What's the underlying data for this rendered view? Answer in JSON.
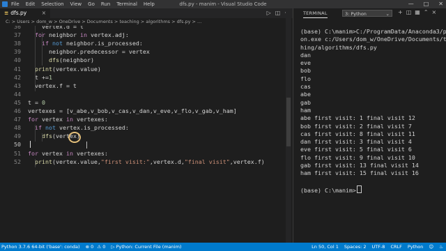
{
  "titlebar": {
    "menu": [
      "File",
      "Edit",
      "Selection",
      "View",
      "Go",
      "Run",
      "Terminal",
      "Help"
    ],
    "title": "dfs.py - manim - Visual Studio Code"
  },
  "editor": {
    "tab_label": "dfs.py",
    "breadcrumbs": "C: > Users > dom_w > OneDrive > Documents > teaching > algorithms > dfs.py > ..."
  },
  "terminal": {
    "tab_label": "TERMINAL",
    "shell_select": "3: Python",
    "lines": [
      "(base) C:\\manim>C:/ProgramData/Anaconda3/pyth",
      "on.exe c:/Users/dom_w/OneDrive/Documents/teac",
      "hing/algorithms/dfs.py",
      "dan",
      "eve",
      "bob",
      "flo",
      "cas",
      "abe",
      "gab",
      "ham",
      "abe first visit: 1 final visit 12",
      "bob first visit: 2 final visit 7",
      "cas first visit: 8 final visit 11",
      "dan first visit: 3 final visit 4",
      "eve first visit: 5 final visit 6",
      "flo first visit: 9 final visit 10",
      "gab first visit: 13 final visit 14",
      "ham first visit: 15 final visit 16",
      "",
      "(base) C:\\manim>"
    ]
  },
  "statusbar": {
    "left": "Python 3.7.6 64-bit ('base': conda)",
    "errors": "0",
    "warnings": "0",
    "run_label": "Python: Current File (manim)",
    "position": "Ln 50, Col 1",
    "spaces": "Spaces: 2",
    "encoding": "UTF-8",
    "eol": "CRLF",
    "language": "Python"
  },
  "code_lines": [
    {
      "n": "36",
      "tokens": [
        [
          "    ",
          "p"
        ],
        [
          "vertex.d = t",
          "p"
        ]
      ]
    },
    {
      "n": "37",
      "tokens": [
        [
          "  ",
          "p"
        ],
        [
          "for",
          "kw"
        ],
        [
          " neighbor ",
          "p"
        ],
        [
          "in",
          "kw"
        ],
        [
          " vertex.adj:",
          "p"
        ]
      ]
    },
    {
      "n": "38",
      "tokens": [
        [
          "    ",
          "p"
        ],
        [
          "if",
          "kw"
        ],
        [
          " ",
          "p"
        ],
        [
          "not",
          "kw2"
        ],
        [
          " neighbor.is_processed:",
          "p"
        ]
      ]
    },
    {
      "n": "39",
      "tokens": [
        [
          "      neighbor.predecessor = vertex",
          "p"
        ]
      ]
    },
    {
      "n": "40",
      "tokens": [
        [
          "      ",
          "p"
        ],
        [
          "dfs",
          "fn"
        ],
        [
          "(neighbor)",
          "p"
        ]
      ]
    },
    {
      "n": "41",
      "tokens": [
        [
          "  ",
          "p"
        ],
        [
          "print",
          "fn"
        ],
        [
          "(vertex.value)",
          "p"
        ]
      ]
    },
    {
      "n": "42",
      "tokens": [
        [
          "  t +=",
          "p"
        ],
        [
          "1",
          "num"
        ]
      ]
    },
    {
      "n": "43",
      "tokens": [
        [
          "  vertex.f = t",
          "p"
        ]
      ]
    },
    {
      "n": "44",
      "tokens": [
        [
          "",
          "p"
        ]
      ]
    },
    {
      "n": "45",
      "tokens": [
        [
          "t = ",
          "p"
        ],
        [
          "0",
          "num"
        ]
      ]
    },
    {
      "n": "46",
      "tokens": [
        [
          "vertexes = [v_abe,v_bob,v_cas,v_dan,v_eve,v_flo,v_gab,v_ham]",
          "p"
        ]
      ]
    },
    {
      "n": "47",
      "tokens": [
        [
          "for",
          "kw"
        ],
        [
          " vertex ",
          "p"
        ],
        [
          "in",
          "kw"
        ],
        [
          " vertexes:",
          "p"
        ]
      ]
    },
    {
      "n": "48",
      "tokens": [
        [
          "  ",
          "p"
        ],
        [
          "if",
          "kw"
        ],
        [
          " ",
          "p"
        ],
        [
          "not",
          "kw2"
        ],
        [
          " vertex.is_processed:",
          "p"
        ]
      ]
    },
    {
      "n": "49",
      "tokens": [
        [
          "    ",
          "p"
        ],
        [
          "dfs",
          "fn"
        ],
        [
          "(vertex)",
          "p"
        ]
      ]
    },
    {
      "n": "50",
      "tokens": [
        [
          "",
          "p"
        ]
      ]
    },
    {
      "n": "51",
      "tokens": [
        [
          "for",
          "kw"
        ],
        [
          " vertex ",
          "p"
        ],
        [
          "in",
          "kw"
        ],
        [
          " vertexes:",
          "p"
        ]
      ]
    },
    {
      "n": "52",
      "tokens": [
        [
          "  ",
          "p"
        ],
        [
          "print",
          "fn"
        ],
        [
          "(vertex.value,",
          "p"
        ],
        [
          "\"first visit:\"",
          "str"
        ],
        [
          ",vertex.d,",
          "p"
        ],
        [
          "\"final visit\"",
          "str"
        ],
        [
          ",vertex.f)",
          "p"
        ]
      ]
    }
  ]
}
